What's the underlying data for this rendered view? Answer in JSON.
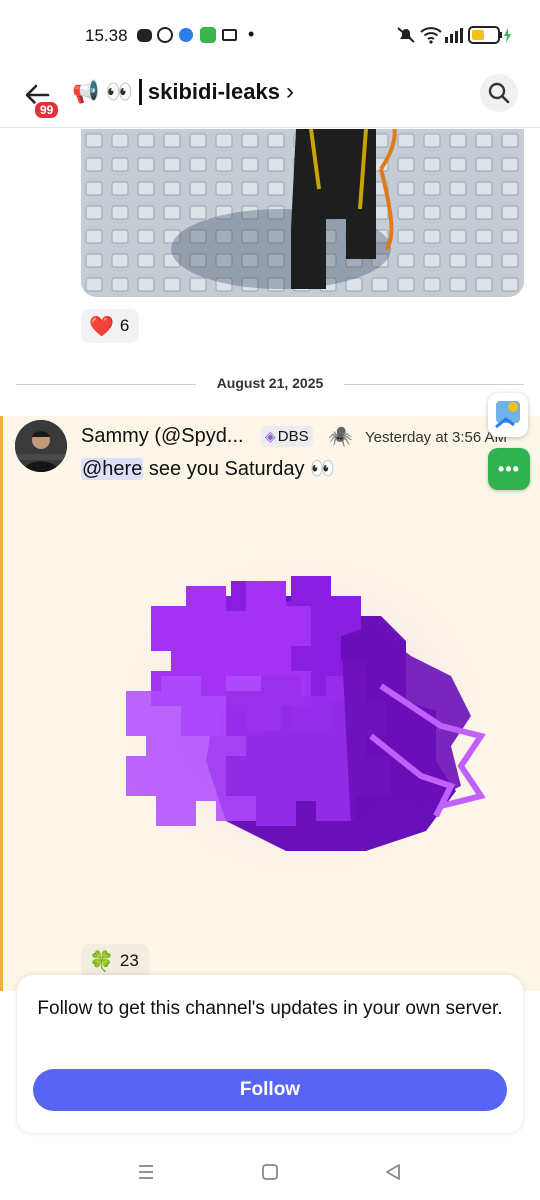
{
  "status_bar": {
    "time": "15.38",
    "dot": "•"
  },
  "header": {
    "badge_count": "99",
    "channel_emojis": "📢 👀",
    "channel_name": "skibidi-leaks",
    "chevron": "›"
  },
  "prev_message": {
    "reaction": {
      "emoji": "❤️",
      "count": "6"
    }
  },
  "date_divider": "August 21, 2025",
  "message": {
    "author": "Sammy (@Spyd...",
    "tag": "DBS",
    "tag_icon": "◈",
    "spider_icon": "🕷️",
    "timestamp": "Yesterday at 3:56 AM",
    "mention": "@here",
    "text": " see you Saturday 👀",
    "reaction": {
      "emoji": "🍀",
      "count": "23"
    }
  },
  "floating": {
    "more_label": "•••"
  },
  "follow_card": {
    "text": "Follow to get this channel's updates in your own server.",
    "button": "Follow"
  },
  "colors": {
    "accent": "#5865f2",
    "highlight_bg": "#fdf6e8",
    "highlight_bar": "#f0b232",
    "badge": "#e0343c",
    "clover_purple": "#a020f0"
  }
}
